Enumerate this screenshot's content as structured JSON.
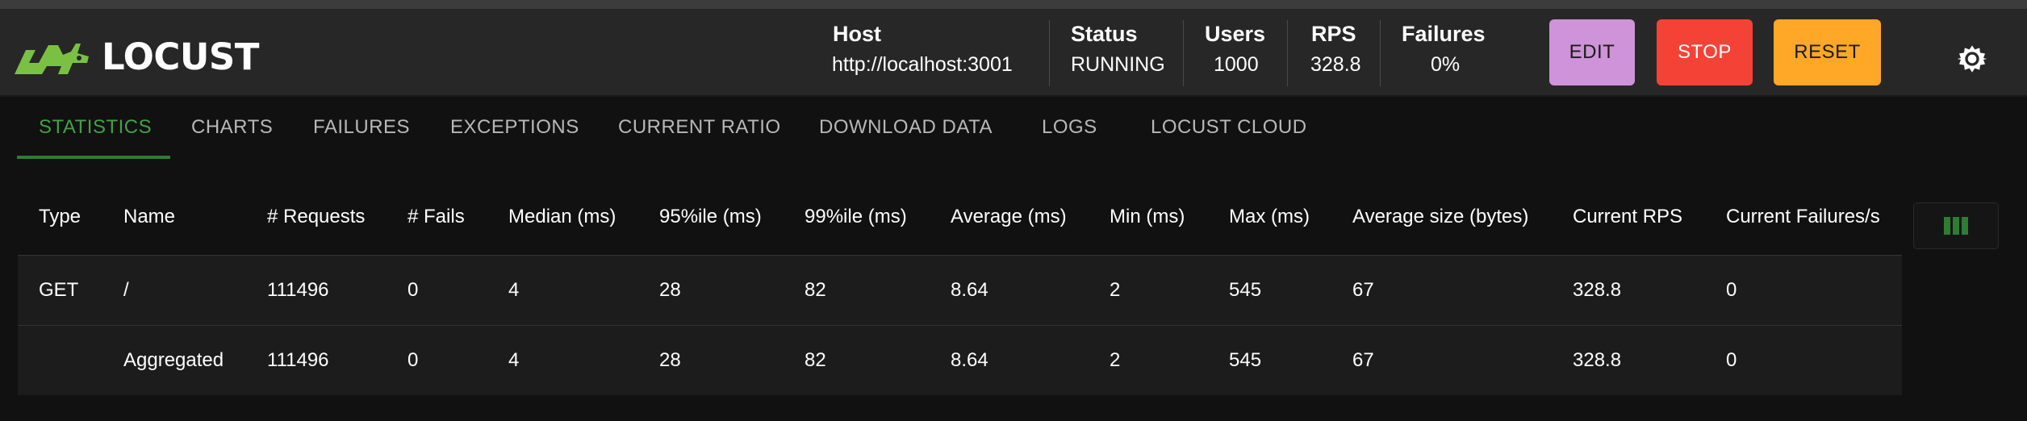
{
  "app": {
    "logo_text": "LOCUST"
  },
  "stats": {
    "host": {
      "label": "Host",
      "value": "http://localhost:3001"
    },
    "status": {
      "label": "Status",
      "value": "RUNNING"
    },
    "users": {
      "label": "Users",
      "value": "1000"
    },
    "rps": {
      "label": "RPS",
      "value": "328.8"
    },
    "failures": {
      "label": "Failures",
      "value": "0%"
    }
  },
  "buttons": {
    "edit": "EDIT",
    "stop": "STOP",
    "reset": "RESET"
  },
  "colors": {
    "accent_green": "#43a047",
    "edit": "#ce93d8",
    "stop": "#f44336",
    "reset": "#ffa726"
  },
  "icons": {
    "logo": "locust-logo-icon",
    "settings": "gear-icon",
    "columns": "columns-icon"
  },
  "tabs": [
    {
      "label": "STATISTICS",
      "active": true
    },
    {
      "label": "CHARTS"
    },
    {
      "label": "FAILURES"
    },
    {
      "label": "EXCEPTIONS"
    },
    {
      "label": "CURRENT RATIO"
    },
    {
      "label": "DOWNLOAD DATA"
    },
    {
      "label": "LOGS"
    },
    {
      "label": "LOCUST CLOUD"
    }
  ],
  "table": {
    "columns": [
      "Type",
      "Name",
      "# Requests",
      "# Fails",
      "Median (ms)",
      "95%ile (ms)",
      "99%ile (ms)",
      "Average (ms)",
      "Min (ms)",
      "Max (ms)",
      "Average size (bytes)",
      "Current RPS",
      "Current Failures/s"
    ],
    "rows": [
      [
        "GET",
        "/",
        "111496",
        "0",
        "4",
        "28",
        "82",
        "8.64",
        "2",
        "545",
        "67",
        "328.8",
        "0"
      ],
      [
        "",
        "Aggregated",
        "111496",
        "0",
        "4",
        "28",
        "82",
        "8.64",
        "2",
        "545",
        "67",
        "328.8",
        "0"
      ]
    ]
  }
}
